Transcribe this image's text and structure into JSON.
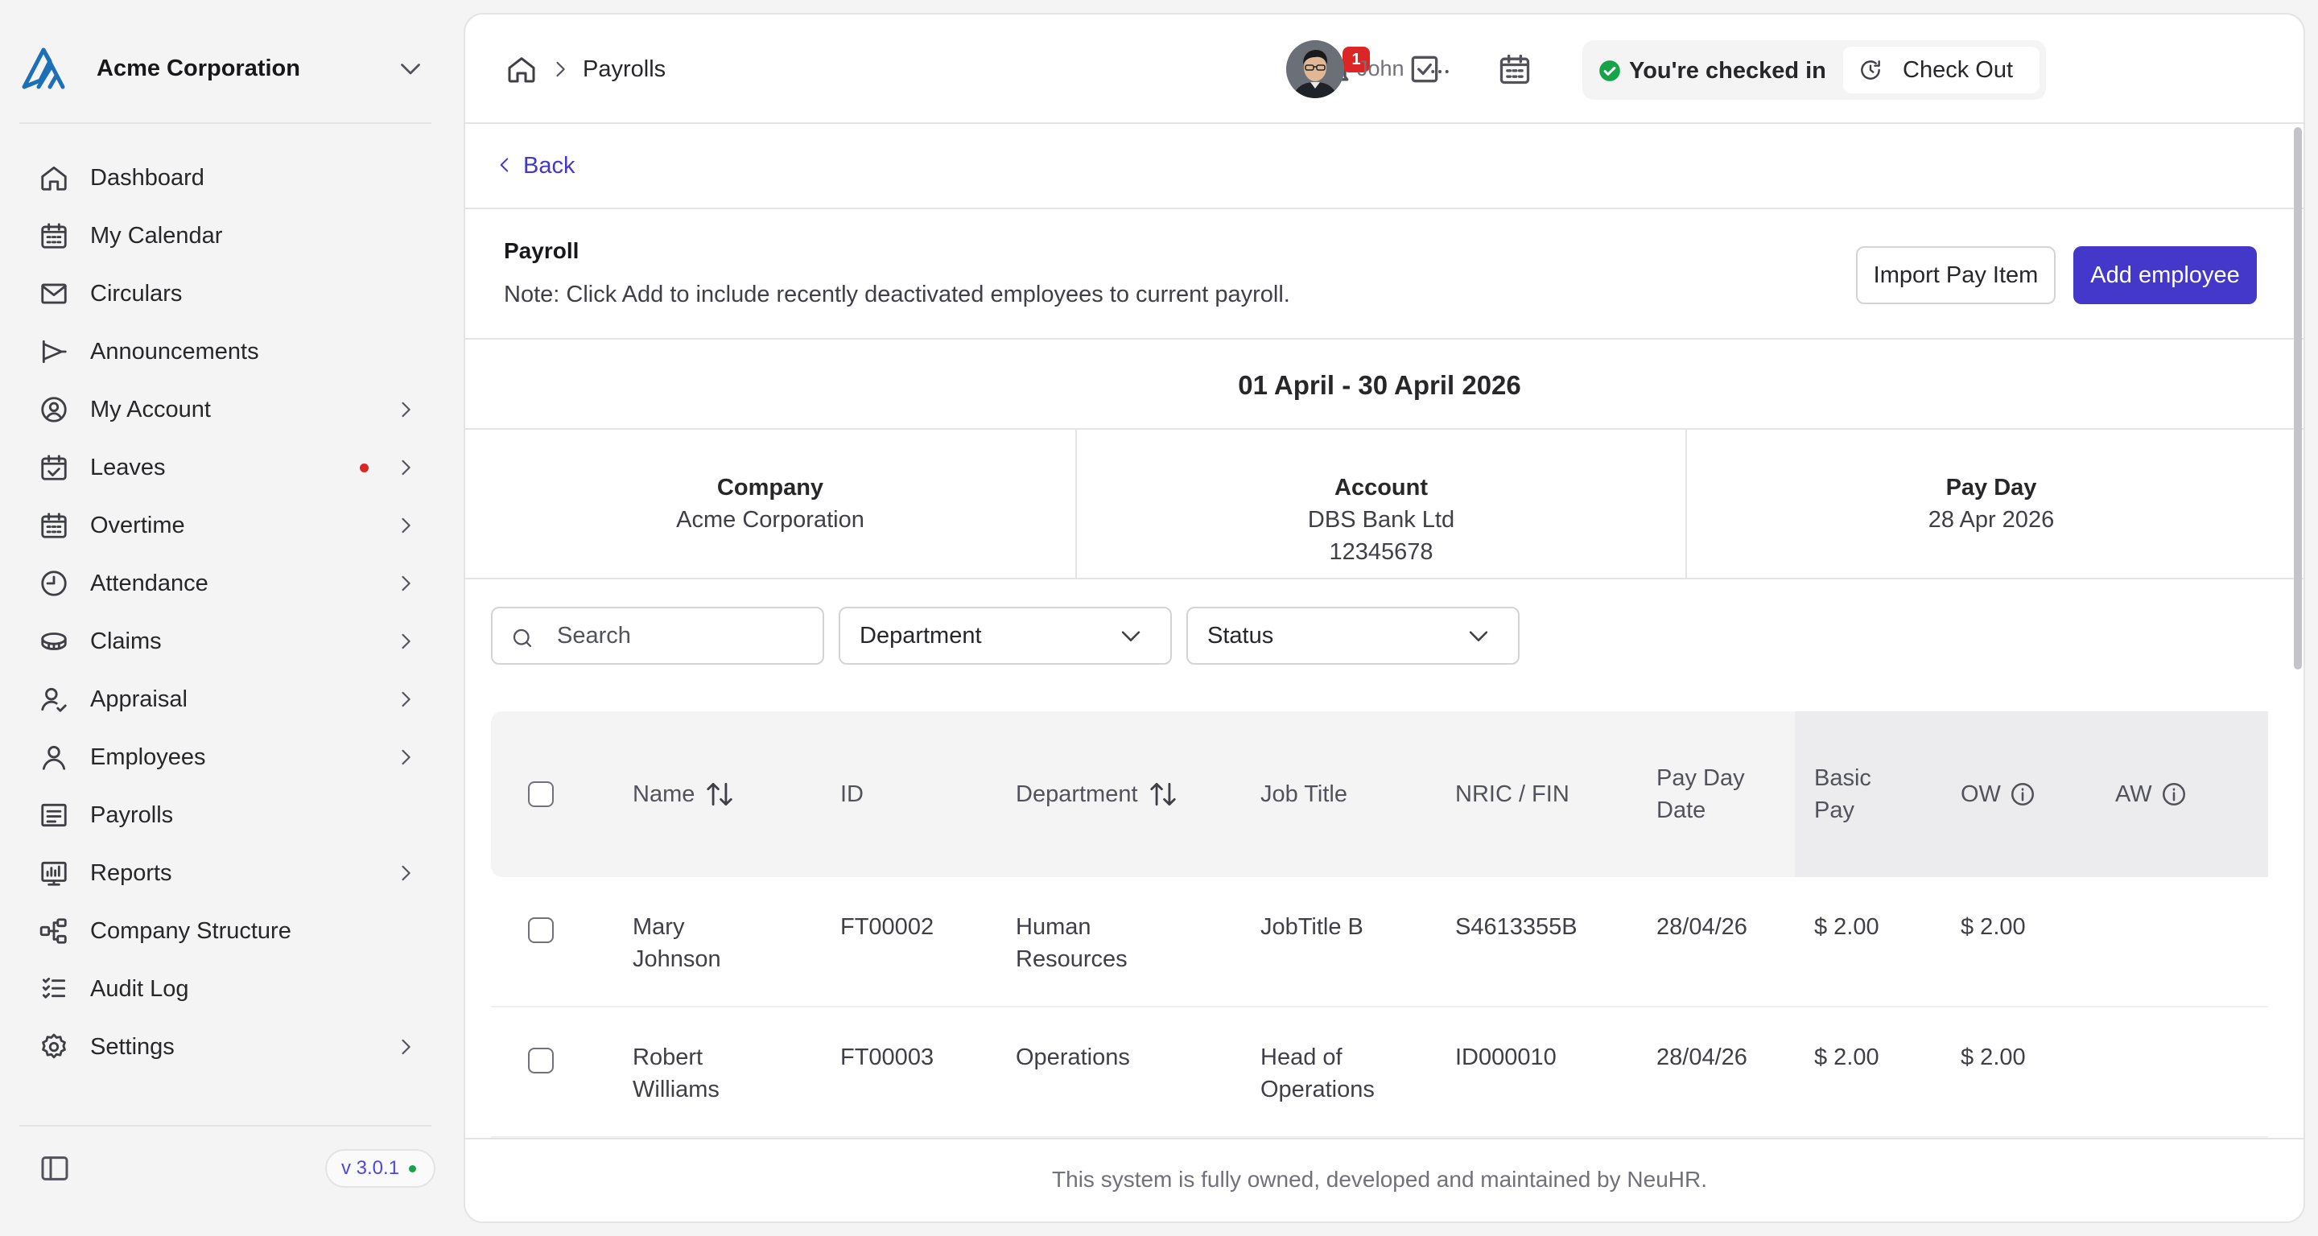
{
  "brand": {
    "name": "Acme Corporation"
  },
  "sidebar": {
    "items": [
      {
        "label": "Dashboard",
        "icon": "home-icon",
        "chevron": false
      },
      {
        "label": "My Calendar",
        "icon": "calendar-icon",
        "chevron": false
      },
      {
        "label": "Circulars",
        "icon": "mail-icon",
        "chevron": false
      },
      {
        "label": "Announcements",
        "icon": "megaphone-icon",
        "chevron": false
      },
      {
        "label": "My Account",
        "icon": "user-circle-icon",
        "chevron": true
      },
      {
        "label": "Leaves",
        "icon": "calendar-check-icon",
        "chevron": true,
        "dot": true
      },
      {
        "label": "Overtime",
        "icon": "calendar-icon",
        "chevron": true
      },
      {
        "label": "Attendance",
        "icon": "clock-icon",
        "chevron": true
      },
      {
        "label": "Claims",
        "icon": "coins-icon",
        "chevron": true
      },
      {
        "label": "Appraisal",
        "icon": "user-check-icon",
        "chevron": true
      },
      {
        "label": "Employees",
        "icon": "user-icon",
        "chevron": true
      },
      {
        "label": "Payrolls",
        "icon": "receipt-icon",
        "chevron": false
      },
      {
        "label": "Reports",
        "icon": "chart-icon",
        "chevron": true
      },
      {
        "label": "Company Structure",
        "icon": "org-chart-icon",
        "chevron": false
      },
      {
        "label": "Audit Log",
        "icon": "checklist-icon",
        "chevron": false
      },
      {
        "label": "Settings",
        "icon": "gear-icon",
        "chevron": true
      }
    ],
    "version": "v 3.0.1"
  },
  "topbar": {
    "breadcrumb_current": "Payrolls",
    "notification_count": "1",
    "checkin_status": "You're checked in",
    "checkout_label": "Check Out",
    "user_name": "John"
  },
  "back_label": "Back",
  "payroll": {
    "title": "Payroll",
    "note": "Note: Click Add to include recently deactivated employees to current payroll.",
    "import_label": "Import Pay Item",
    "add_label": "Add employee",
    "period": "01 April - 30 April 2026"
  },
  "info": {
    "company_label": "Company",
    "company_value": "Acme Corporation",
    "account_label": "Account",
    "account_bank": "DBS Bank Ltd",
    "account_number": "12345678",
    "payday_label": "Pay Day",
    "payday_value": "28 Apr 2026"
  },
  "filters": {
    "search_placeholder": "Search",
    "department_label": "Department",
    "status_label": "Status"
  },
  "table": {
    "headers": {
      "name": "Name",
      "id": "ID",
      "department": "Department",
      "job_title": "Job Title",
      "nric": "NRIC / FIN",
      "pay_day_date_1": "Pay Day",
      "pay_day_date_2": "Date",
      "basic_pay_1": "Basic",
      "basic_pay_2": "Pay",
      "ow": "OW",
      "aw": "AW"
    },
    "rows": [
      {
        "name_1": "Mary",
        "name_2": "Johnson",
        "id": "FT00002",
        "dept_1": "Human",
        "dept_2": "Resources",
        "job_1": "JobTitle B",
        "job_2": "",
        "nric": "S4613355B",
        "pay_date": "28/04/26",
        "basic": "$ 2.00",
        "ow": "$ 2.00",
        "aw": ""
      },
      {
        "name_1": "Robert",
        "name_2": "Williams",
        "id": "FT00003",
        "dept_1": "Operations",
        "dept_2": "",
        "job_1": "Head of",
        "job_2": "Operations",
        "nric": "ID000010",
        "pay_date": "28/04/26",
        "basic": "$ 2.00",
        "ow": "$ 2.00",
        "aw": ""
      }
    ]
  },
  "footer": {
    "text": "This system is fully owned, developed and maintained by NeuHR."
  },
  "colors": {
    "accent": "#4338ca",
    "brand": "#1d6fb8",
    "badge": "#dc2626",
    "success": "#16a34a"
  }
}
